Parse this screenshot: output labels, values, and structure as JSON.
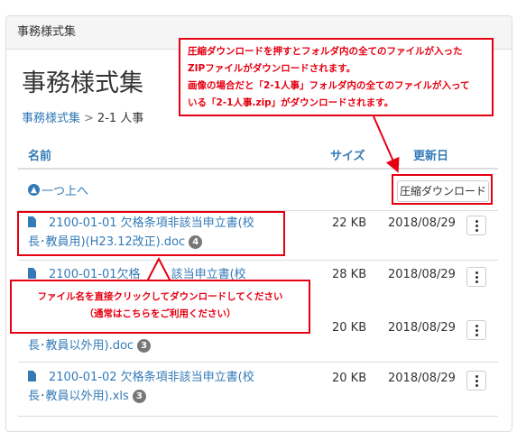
{
  "panel": {
    "heading": "事務様式集"
  },
  "page": {
    "title": "事務様式集"
  },
  "breadcrumb": {
    "root": "事務様式集",
    "separator": ">",
    "current": "2-1 人事"
  },
  "table": {
    "headers": {
      "name": "名前",
      "size": "サイズ",
      "updated": "更新日"
    },
    "up_label": "一つ上へ",
    "zip_button_label": "圧縮ダウンロード",
    "files": [
      {
        "name_line1": "2100-01-01 欠格条項非該当申立書(校",
        "name_line2": "長･教員用)(H23.12改正).doc",
        "badge": "4",
        "size": "22 KB",
        "date": "2018/08/29"
      },
      {
        "name_line1": "2100-01-01欠格",
        "name_line1b": "該当申立書(校",
        "size": "28 KB",
        "date": "2018/08/29"
      },
      {
        "name_line2": "長･教員以外用).doc",
        "badge": "3",
        "size": "20 KB",
        "date": "2018/08/29"
      },
      {
        "name_line1": "2100-01-02 欠格条項非該当申立書(校",
        "name_line2": "長･教員以外用).xls",
        "badge": "3",
        "size": "20 KB",
        "date": "2018/08/29"
      }
    ]
  },
  "callouts": {
    "zip": {
      "line1": "圧縮ダウンロードを押すとフォルダ内の全てのファイルが入った",
      "line2": "ZIPファイルがダウンロードされます。",
      "line3": "画像の場合だと「2-1人事」フォルダ内の全てのファイルが入って",
      "line4": "いる「2-1人事.zip」がダウンロードされます。"
    },
    "file": {
      "line1": "ファイル名を直接クリックしてダウンロードしてください",
      "line2": "（通常はこちらをご利用ください）"
    }
  },
  "colors": {
    "accent": "#337ab7",
    "annotation": "#e50012",
    "badge": "#777777"
  },
  "icons": {
    "up": "circle-arrow-up-icon",
    "file": "file-icon",
    "menu": "kebab-menu-icon"
  }
}
